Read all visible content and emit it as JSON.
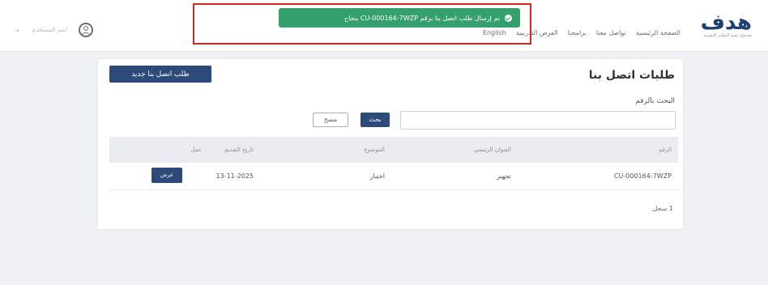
{
  "header": {
    "logo_text": "هدف",
    "logo_subtitle": "صندوق تنمية الموارد البشرية",
    "nav": [
      "الصفحة الرئيسية",
      "تواصل معنا",
      "برامجنا",
      "الفرص التدريبية",
      "English"
    ],
    "user_name": "اسم المستخدم"
  },
  "toast": {
    "message": "تم إرسال طلب اتصل بنا برقم CU-000164-7WZP بنجاح"
  },
  "page": {
    "title": "طلبات اتصل بنا",
    "new_request_label": "طلب اتصل بنا جديد",
    "search_label": "البحث بالرقم",
    "search_value": "",
    "search_button": "بحث",
    "clear_button": "مسح"
  },
  "table": {
    "columns": [
      "الرقم",
      "العنوان الرئيسي",
      "الموضوع",
      "تاريخ التقديم",
      "عمل"
    ],
    "rows": [
      {
        "number": "CU-000164-7WZP",
        "main_title": "تجهيز",
        "subject": "اختبار",
        "date": "13-11-2025",
        "action": "عرض"
      }
    ]
  },
  "footer": {
    "count_text": "1 سجل"
  }
}
